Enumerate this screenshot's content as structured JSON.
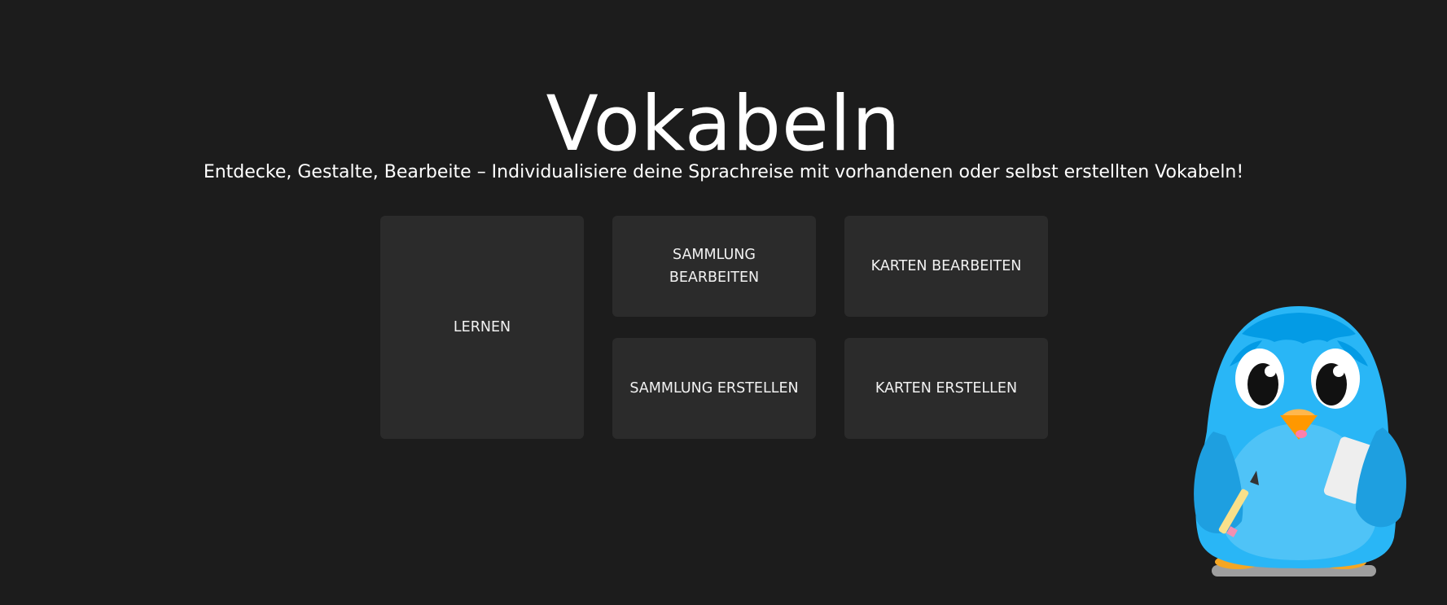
{
  "page": {
    "title": "Vokabeln",
    "subtitle": "Entdecke, Gestalte, Bearbeite – Individualisiere deine Sprachreise mit vorhandenen oder selbst erstellten Vokabeln!"
  },
  "menu": {
    "learn": "LERNEN",
    "edit_collection": "SAMMLUNG BEARBEITEN",
    "edit_cards": "KARTEN BEARBEITEN",
    "create_collection": "SAMMLUNG ERSTELLEN",
    "create_cards": "KARTEN ERSTELLEN"
  },
  "colors": {
    "background": "#1c1c1c",
    "tile": "#2b2b2b",
    "text": "#ffffff",
    "mascot_body": "#29b6f6"
  },
  "icons": {
    "mascot": "penguin-mascot-icon"
  }
}
